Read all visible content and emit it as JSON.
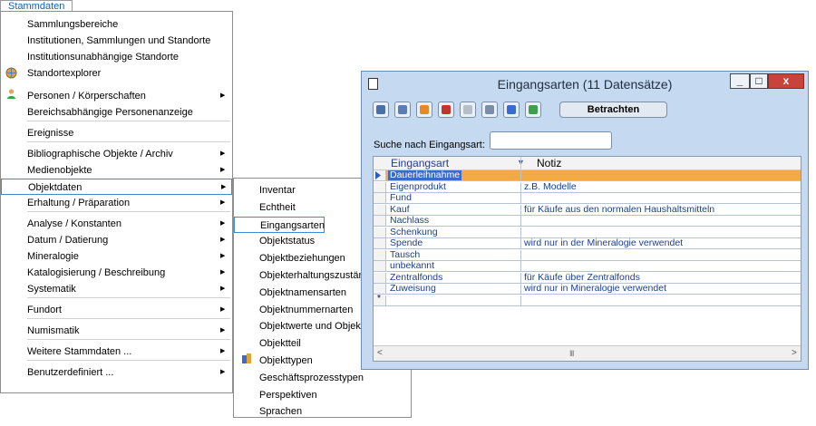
{
  "tab": {
    "label": "Stammdaten"
  },
  "menu": {
    "items": [
      {
        "label": "Sammlungsbereiche",
        "arrow": false,
        "icon": ""
      },
      {
        "label": "Institutionen, Sammlungen und Standorte",
        "arrow": false,
        "icon": ""
      },
      {
        "label": "Institutionsunabhängige Standorte",
        "arrow": false,
        "icon": ""
      },
      {
        "label": "Standortexplorer",
        "arrow": false,
        "icon": "globe-icon"
      },
      {
        "label": "Personen / Körperschaften",
        "arrow": true,
        "icon": "person-icon"
      },
      {
        "label": "Bereichsabhängige Personenanzeige",
        "arrow": false,
        "icon": ""
      },
      {
        "label": "Ereignisse",
        "arrow": false,
        "icon": ""
      },
      {
        "label": "Bibliographische Objekte / Archiv",
        "arrow": true,
        "icon": ""
      },
      {
        "label": "Medienobjekte",
        "arrow": true,
        "icon": ""
      },
      {
        "label": "Objektdaten",
        "arrow": true,
        "icon": ""
      },
      {
        "label": "Erhaltung / Präparation",
        "arrow": true,
        "icon": ""
      },
      {
        "label": "Analyse / Konstanten",
        "arrow": true,
        "icon": ""
      },
      {
        "label": "Datum / Datierung",
        "arrow": true,
        "icon": ""
      },
      {
        "label": "Mineralogie",
        "arrow": true,
        "icon": ""
      },
      {
        "label": "Katalogisierung / Beschreibung",
        "arrow": true,
        "icon": ""
      },
      {
        "label": "Systematik",
        "arrow": true,
        "icon": ""
      },
      {
        "label": "Fundort",
        "arrow": true,
        "icon": ""
      },
      {
        "label": "Numismatik",
        "arrow": true,
        "icon": ""
      },
      {
        "label": "Weitere Stammdaten ...",
        "arrow": true,
        "icon": ""
      },
      {
        "label": "Benutzerdefiniert ...",
        "arrow": true,
        "icon": ""
      }
    ]
  },
  "submenu": {
    "items": [
      "Inventar",
      "Echtheit",
      "Eingangsarten",
      "Objektstatus",
      "Objektbeziehungen",
      "Objekterhaltungszustände",
      "Objektnamensarten",
      "Objektnummernarten",
      "Objektwerte und Objektmaße",
      "Objektteil",
      "Objekttypen",
      "Geschäftsprozesstypen",
      "Perspektiven",
      "Sprachen"
    ],
    "selected": "Eingangsarten"
  },
  "window": {
    "title": "Eingangsarten (11 Datensätze)",
    "minimize": "_",
    "maximize": "□",
    "close": "x",
    "toolbar_button": "Betrachten",
    "search_label": "Suche nach Eingangsart:",
    "search_value": "",
    "grid": {
      "col1": "Eingangsart",
      "col2": "Notiz",
      "rows": [
        {
          "a": "Dauerleihnahme",
          "b": ""
        },
        {
          "a": "Eigenprodukt",
          "b": "z.B. Modelle"
        },
        {
          "a": "Fund",
          "b": ""
        },
        {
          "a": "Kauf",
          "b": "für Käufe aus den normalen Haushaltsmitteln"
        },
        {
          "a": "Nachlass",
          "b": ""
        },
        {
          "a": "Schenkung",
          "b": ""
        },
        {
          "a": "Spende",
          "b": "wird nur in der Mineralogie verwendet"
        },
        {
          "a": "Tausch",
          "b": ""
        },
        {
          "a": "unbekannt",
          "b": ""
        },
        {
          "a": "Zentralfonds",
          "b": "für Käufe über Zentralfonds"
        },
        {
          "a": "Zuweisung",
          "b": "wird nur in Mineralogie verwendet"
        }
      ],
      "scroll_left": "<",
      "scroll_right": ">",
      "scroll_thumb": "III"
    }
  },
  "colors": {
    "accent": "#3c8ad8",
    "active_row": "#f5a84a",
    "window_bg": "#c5daf1"
  }
}
